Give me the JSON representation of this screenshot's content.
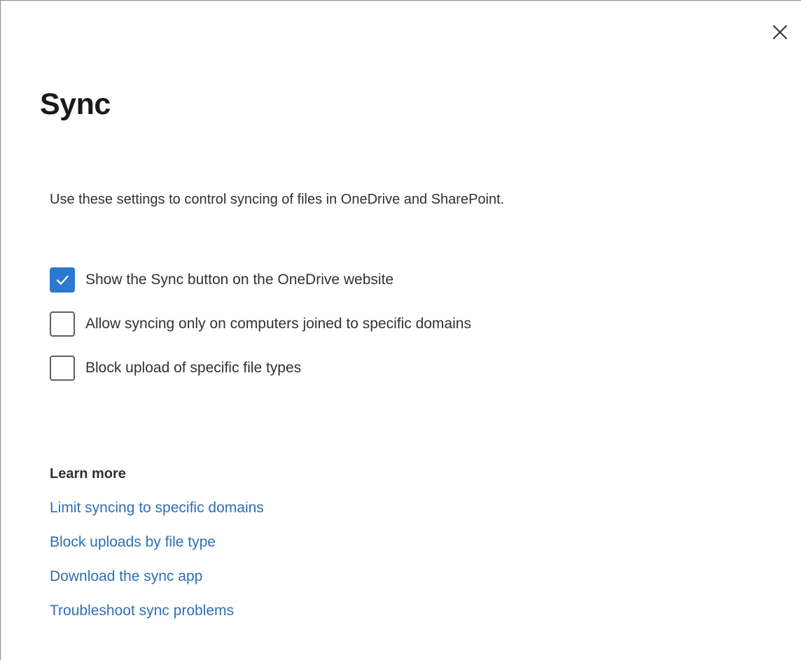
{
  "panel": {
    "close_icon": "close-icon",
    "title": "Sync",
    "description": "Use these settings to control syncing of files in OneDrive and SharePoint."
  },
  "options": [
    {
      "label": "Show the Sync button on the OneDrive website",
      "checked": true
    },
    {
      "label": "Allow syncing only on computers joined to specific domains",
      "checked": false
    },
    {
      "label": "Block upload of specific file types",
      "checked": false
    }
  ],
  "learn_more": {
    "heading": "Learn more",
    "links": [
      "Limit syncing to specific domains",
      "Block uploads by file type",
      "Download the sync app",
      "Troubleshoot sync problems"
    ]
  },
  "colors": {
    "accent": "#2b78d0",
    "link": "#2f6fb5",
    "text": "#323130"
  }
}
